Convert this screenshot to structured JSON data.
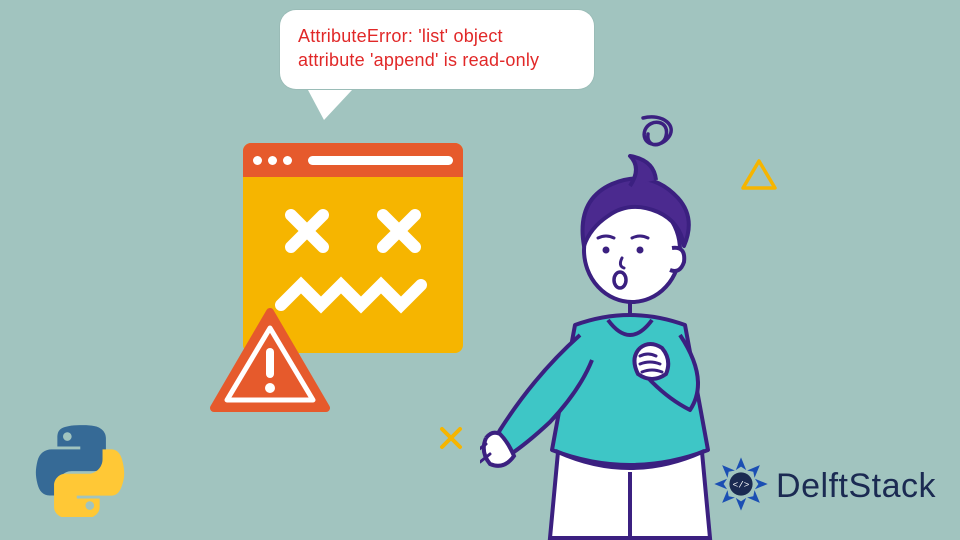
{
  "bubble": {
    "line1": "AttributeError: 'list' object",
    "line2": "attribute 'append' is read-only"
  },
  "brand": {
    "name": "DelftStack"
  },
  "colors": {
    "bg": "#a1c4bf",
    "error_text": "#e12828",
    "window_body": "#f6b500",
    "window_header": "#e65a2c",
    "outline": "#3b2080",
    "accent_purple": "#4b2a8f",
    "accent_teal": "#3ec6c6",
    "brand_blue": "#1b2a52"
  }
}
